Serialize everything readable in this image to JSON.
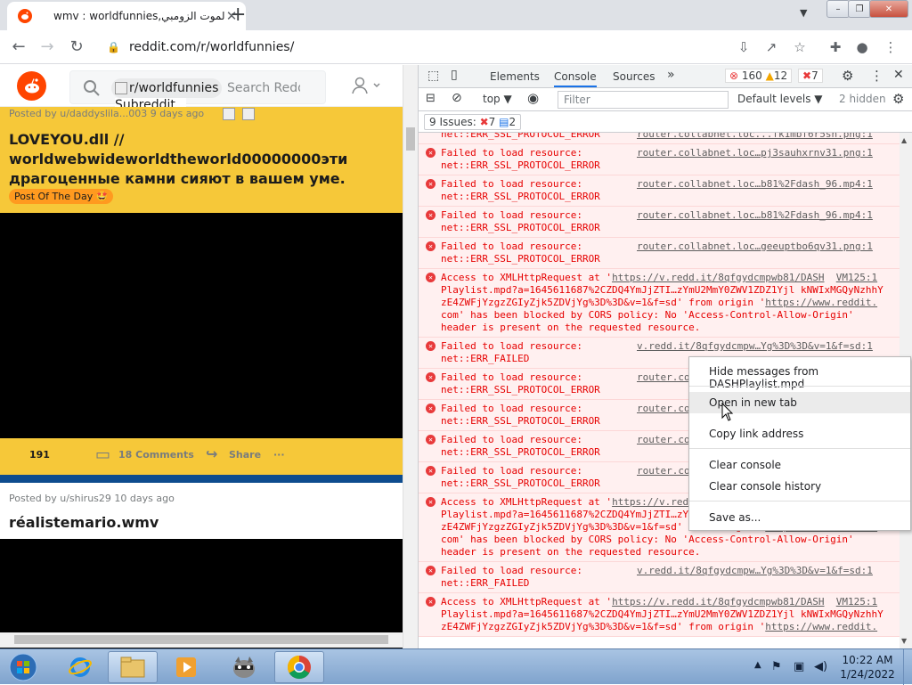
{
  "browser": {
    "tab_title": "wmv : worldfunnies,الموت الزومبي",
    "tab_close": "✕",
    "new_tab": "+",
    "url": "reddit.com/r/worldfunnies/",
    "window_controls": [
      "–",
      "❐",
      "✕"
    ]
  },
  "reddit": {
    "subreddit_chip": "r/worldfunnies",
    "subreddit_icon_alt": "Subreddit Icon",
    "search_placeholder": "Search Reddit",
    "post1": {
      "meta": "Posted by u/daddyslila...003 9 days ago",
      "title": "LOVEYOU.dll // worldwebwideworldtheworld00000000эти драгоценные камни сияют в вашем уме.",
      "flair": "Post Of The Day 🤩",
      "votes": "191",
      "comments": "18 Comments",
      "share": "Share",
      "more": "···"
    },
    "post2": {
      "meta": "Posted by u/shirus29 10 days ago",
      "title": "réalistemario.wmv"
    }
  },
  "devtools": {
    "tabs": [
      "Elements",
      "Console",
      "Sources"
    ],
    "more_tabs": "»",
    "errors_count": "160",
    "warnings_count": "12",
    "issues_badge": "7",
    "context_select": "top ▼",
    "filter_placeholder": "Filter",
    "levels": "Default levels ▼",
    "hidden": "2 hidden",
    "issues_label": "9 Issues:",
    "issues_errors": "7",
    "issues_info": "2",
    "messages": [
      {
        "line1": "",
        "line2": "net::ERR_SSL_PROTOCOL_ERROR",
        "src": "router.collabnet.loc...fk1mbf6r5sh.png:1"
      },
      {
        "line1": "Failed to load resource:",
        "line2": "net::ERR_SSL_PROTOCOL_ERROR",
        "src": "router.collabnet.loc…pj3sauhxrnv31.png:1"
      },
      {
        "line1": "Failed to load resource:",
        "line2": "net::ERR_SSL_PROTOCOL_ERROR",
        "src": "router.collabnet.loc…b81%2Fdash_96.mp4:1"
      },
      {
        "line1": "Failed to load resource:",
        "line2": "net::ERR_SSL_PROTOCOL_ERROR",
        "src": "router.collabnet.loc…b81%2Fdash_96.mp4:1"
      },
      {
        "line1": "Failed to load resource:",
        "line2": "net::ERR_SSL_PROTOCOL_ERROR",
        "src": "router.collabnet.loc…geeuptbo6qv31.png:1"
      }
    ],
    "cors1": {
      "l1": "Access to XMLHttpRequest at '",
      "l1_link": "https://v.redd.it/8qfgydcmpwb81/DASH",
      "l1_src": "VM125:1",
      "l2": "Playlist.mpd?a=1645611687%2CZDQ4YmJjZTI…zYmU2MmY0ZWV1ZDZ1Yjl kNWIxMGQyNzhhY",
      "l3": "zE4ZWFjYzgzZGIyZjk5ZDVjYg%3D%3D&v=1&f=sd' from origin '",
      "l3_link": "https://www.reddit.",
      "l4": "com' has been blocked by CORS policy: No 'Access-Control-Allow-Origin'",
      "l5": "header is present on the requested resource."
    },
    "failed_msg": {
      "line1": "Failed to load resource:",
      "line2": "net::ERR_FAILED",
      "src": "v.redd.it/8qfgydcmpw…Yg%3D%3D&v=1&f=sd:1"
    },
    "ssl_msg": {
      "line1": "Failed to load resource:",
      "line2": "net::ERR_SSL_PROTOCOL_ERROR",
      "src": "router.collabnet.loc…"
    },
    "cors2": {
      "l1": "Access to XMLHttpRequest at '",
      "l1_link": "https://v.redd.it/8qfgydcmpwb81/DASH",
      "l1_src": "VM125:1",
      "l2": "Playlist.mpd?a=1645611687%2CZDQ4YmJjZTI…zYmU2MmY0ZWV1ZDZ1Yjl kNWIxMGQyNzhhY",
      "l3": "zE4ZWFjYzgzZGIyZjk5ZDVjYg%3D%3D&v=1&f=sd' from origin '",
      "l3_link": "https://www.reddit.",
      "l4": "com' has been blocked by CORS policy: No 'Access-Control-Allow-Origin'",
      "l5": "header is present on the requested resource."
    }
  },
  "context_menu": {
    "items": [
      "Hide messages from DASHPlaylist.mpd",
      "Open in new tab",
      "Copy link address",
      "Clear console",
      "Clear console history",
      "Save as..."
    ]
  },
  "taskbar": {
    "time": "10:22 AM",
    "date": "1/24/2022"
  },
  "colors": {
    "reddit_orange": "#ff4500",
    "post_gold": "#f6c839",
    "error_red": "#e60000",
    "error_bg": "#fff0f0"
  }
}
